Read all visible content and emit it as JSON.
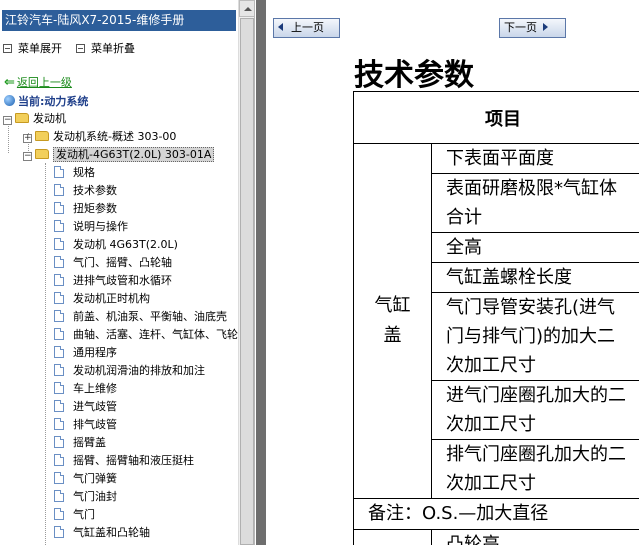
{
  "left_panel": {
    "title": "江铃汽车-陆风X7-2015-维修手册",
    "expand_label": "菜单展开",
    "collapse_label": "菜单折叠",
    "back_label": "返回上一级",
    "current_label": "当前:动力系统",
    "tree": {
      "root": "发动机",
      "children": [
        {
          "label": "发动机系统-概述 303-00"
        },
        {
          "label": "发动机-4G63T(2.0L) 303-01A",
          "selected": true
        }
      ],
      "docs": [
        "规格",
        "技术参数",
        "扭矩参数",
        "说明与操作",
        "发动机 4G63T(2.0L)",
        "气门、摇臂、凸轮轴",
        "进排气歧管和水循环",
        "发动机正时机构",
        "前盖、机油泵、平衡轴、油底壳",
        "曲轴、活塞、连杆、气缸体、飞轮",
        "通用程序",
        "发动机润滑油的排放和加注",
        "车上维修",
        "进气歧管",
        "排气歧管",
        "摇臂盖",
        "摇臂、摇臂轴和液压挺柱",
        "气门弹簧",
        "气门油封",
        "气门",
        "气缸盖和凸轮轴"
      ]
    }
  },
  "nav": {
    "prev_label": "上一页",
    "next_label": "下一页"
  },
  "content": {
    "heading": "技术参数",
    "table_header": "项目",
    "category": "气缸盖",
    "rows": [
      [
        "下表面平面度"
      ],
      [
        "表面研磨极限*气缸体",
        "合计"
      ],
      [
        "全高"
      ],
      [
        "气缸盖螺栓长度"
      ],
      [
        "气门导管安装孔(进气",
        "门与排气门)的加大二",
        "次加工尺寸"
      ],
      [
        "进气门座圈孔加大的二",
        "次加工尺寸"
      ],
      [
        "排气门座圈孔加大的二",
        "次加工尺寸"
      ]
    ],
    "note": "备注：O.S.—加大直径",
    "partial_row": "凸轮高"
  }
}
